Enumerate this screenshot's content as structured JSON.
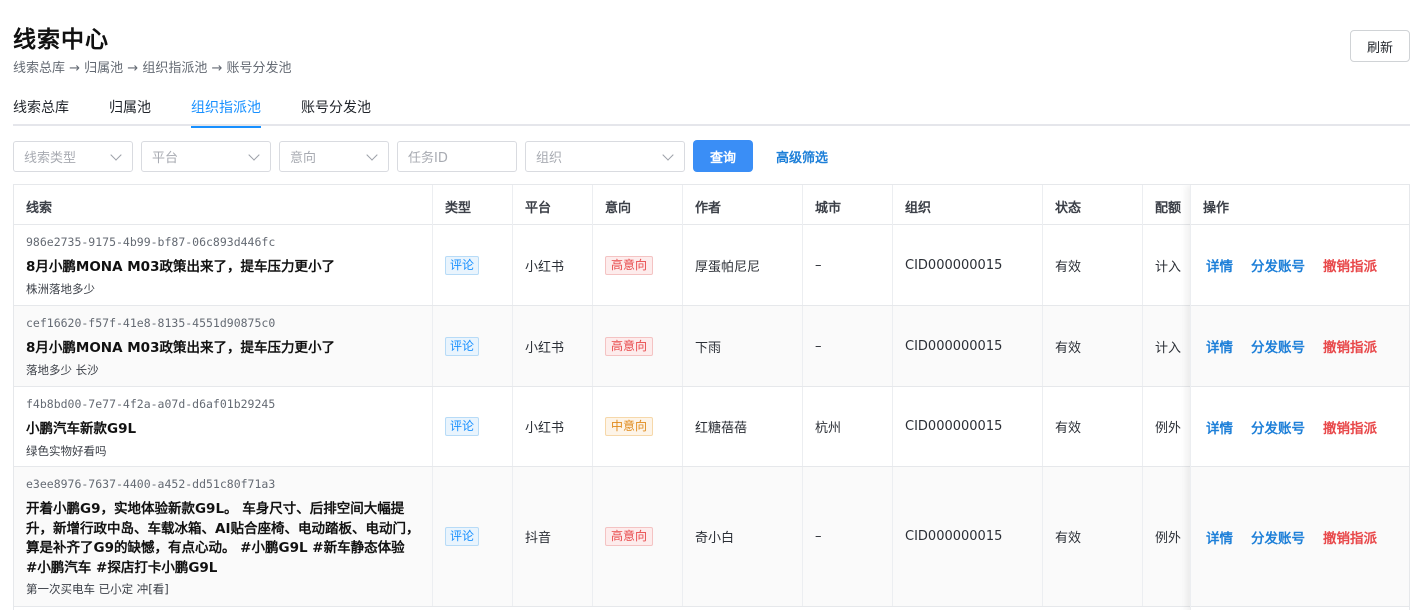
{
  "header": {
    "title": "线索中心",
    "breadcrumb": "线索总库 → 归属池 → 组织指派池 → 账号分发池",
    "refresh_label": "刷新"
  },
  "tabs": [
    {
      "label": "线索总库",
      "active": false
    },
    {
      "label": "归属池",
      "active": false
    },
    {
      "label": "组织指派池",
      "active": true
    },
    {
      "label": "账号分发池",
      "active": false
    }
  ],
  "filters": {
    "clue_type_placeholder": "线索类型",
    "platform_placeholder": "平台",
    "intent_placeholder": "意向",
    "task_id_placeholder": "任务ID",
    "org_placeholder": "组织",
    "query_label": "查询",
    "advanced_label": "高级筛选"
  },
  "table": {
    "columns": [
      "线索",
      "类型",
      "平台",
      "意向",
      "作者",
      "城市",
      "组织",
      "状态",
      "配额",
      "操作"
    ],
    "action_labels": {
      "detail": "详情",
      "dispatch": "分发账号",
      "revoke": "撤销指派"
    },
    "rows": [
      {
        "id": "986e2735-9175-4b99-bf87-06c893d446fc",
        "title": "8月小鹏MONA M03政策出来了，提车压力更小了",
        "sub": "株洲落地多少",
        "type": "评论",
        "platform": "小红书",
        "intent": "高意向",
        "intent_color": "#e8484a",
        "author": "厚蛋帕尼尼",
        "city": "–",
        "org": "CID000000015",
        "status": "有效",
        "quota": "计入"
      },
      {
        "id": "cef16620-f57f-41e8-8135-4551d90875c0",
        "title": "8月小鹏MONA M03政策出来了，提车压力更小了",
        "sub": "落地多少 长沙",
        "type": "评论",
        "platform": "小红书",
        "intent": "高意向",
        "intent_color": "#e8484a",
        "author": "下雨",
        "city": "–",
        "org": "CID000000015",
        "status": "有效",
        "quota": "计入"
      },
      {
        "id": "f4b8bd00-7e77-4f2a-a07d-d6af01b29245",
        "title": "小鹏汽车新款G9L",
        "sub": "绿色实物好看吗",
        "type": "评论",
        "platform": "小红书",
        "intent": "中意向",
        "intent_color": "#e08a1b",
        "author": "红糖蓓蓓",
        "city": "杭州",
        "org": "CID000000015",
        "status": "有效",
        "quota": "例外"
      },
      {
        "id": "e3ee8976-7637-4400-a452-dd51c80f71a3",
        "title": "开着小鹏G9，实地体验新款G9L。 车身尺寸、后排空间大幅提升，新增行政中岛、车载冰箱、AI贴合座椅、电动踏板、电动门，算是补齐了G9的缺憾，有点心动。 #小鹏G9L #新车静态体验 #小鹏汽车 #探店打卡小鹏G9L",
        "sub": "第一次买电车 已小定 冲[看]",
        "type": "评论",
        "platform": "抖音",
        "intent": "高意向",
        "intent_color": "#e8484a",
        "author": "奇小白",
        "city": "–",
        "org": "CID000000015",
        "status": "有效",
        "quota": "例外"
      }
    ]
  }
}
